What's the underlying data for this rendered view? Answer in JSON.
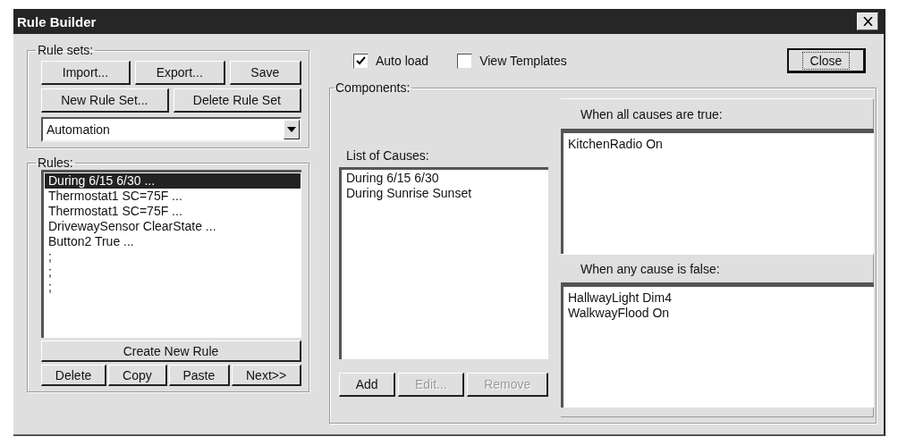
{
  "window": {
    "title": "Rule Builder"
  },
  "rule_sets": {
    "label": "Rule sets:",
    "button_rows": [
      [
        {
          "label": "Import..."
        },
        {
          "label": "Export..."
        },
        {
          "label": "Save"
        }
      ],
      [
        {
          "label": "New Rule Set..."
        },
        {
          "label": "Delete Rule Set"
        }
      ]
    ],
    "dropdown": {
      "value": "Automation"
    }
  },
  "rules": {
    "label": "Rules:",
    "items": [
      {
        "text": "During 6/15 6/30 ...",
        "selected": true
      },
      {
        "text": "Thermostat1 SC=75F ...",
        "selected": false
      },
      {
        "text": "Thermostat1 SC=75F ...",
        "selected": false
      },
      {
        "text": "DrivewaySensor ClearState ...",
        "selected": false
      },
      {
        "text": "Button2 True ...",
        "selected": false
      },
      {
        "text": ";",
        "selected": false
      },
      {
        "text": ";",
        "selected": false
      },
      {
        "text": ";",
        "selected": false
      }
    ],
    "button_rows": [
      [
        {
          "label": "Create New Rule"
        }
      ],
      [
        {
          "label": "Delete"
        },
        {
          "label": "Copy"
        },
        {
          "label": "Paste"
        },
        {
          "label": "Next>>"
        }
      ]
    ]
  },
  "options": [
    {
      "label": "Auto load",
      "checked": true
    },
    {
      "label": "View Templates",
      "checked": false
    }
  ],
  "close_button": {
    "label": "Close",
    "focused": true
  },
  "components": {
    "label": "Components:",
    "causes": {
      "label": "List of Causes:",
      "items": [
        "During 6/15 6/30",
        "During Sunrise Sunset"
      ]
    },
    "cause_buttons": [
      {
        "label": "Add",
        "disabled": false
      },
      {
        "label": "Edit...",
        "disabled": true
      },
      {
        "label": "Remove",
        "disabled": true
      }
    ],
    "when_true": {
      "label": "When all causes are true:",
      "items": [
        "KitchenRadio On"
      ]
    },
    "when_false": {
      "label": "When any cause is false:",
      "items": [
        "HallwayLight Dim4",
        "WalkwayFlood On"
      ]
    }
  }
}
